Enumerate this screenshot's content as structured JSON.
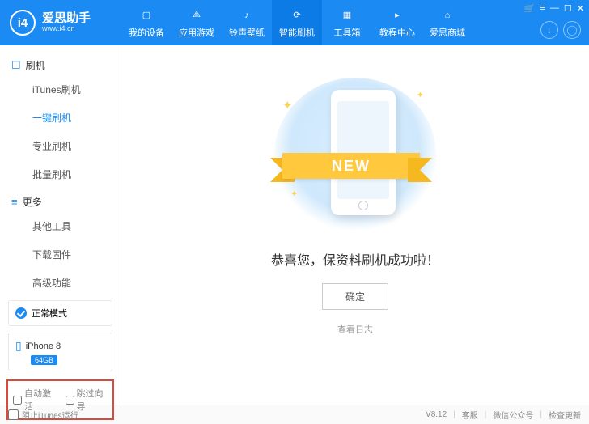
{
  "logo": {
    "badge": "i4",
    "title": "爱思助手",
    "url": "www.i4.cn"
  },
  "nav": [
    {
      "label": "我的设备"
    },
    {
      "label": "应用游戏"
    },
    {
      "label": "铃声壁纸"
    },
    {
      "label": "智能刷机",
      "active": true
    },
    {
      "label": "工具箱"
    },
    {
      "label": "教程中心"
    },
    {
      "label": "爱思商城"
    }
  ],
  "winbtns": [
    "🛒",
    "≡",
    "—",
    "☐",
    "✕"
  ],
  "sidebar": {
    "groups": [
      {
        "icon": "☐",
        "title": "刷机",
        "items": [
          {
            "label": "iTunes刷机"
          },
          {
            "label": "一键刷机",
            "active": true
          },
          {
            "label": "专业刷机"
          },
          {
            "label": "批量刷机"
          }
        ]
      },
      {
        "icon": "≡",
        "title": "更多",
        "items": [
          {
            "label": "其他工具"
          },
          {
            "label": "下载固件"
          },
          {
            "label": "高级功能"
          }
        ]
      }
    ],
    "status": "正常模式",
    "device": {
      "name": "iPhone 8",
      "storage": "64GB"
    },
    "checks": [
      "自动激活",
      "跳过向导"
    ]
  },
  "main": {
    "ribbon": "NEW",
    "message": "恭喜您，保资料刷机成功啦！",
    "button": "确定",
    "loglink": "查看日志"
  },
  "footer": {
    "block_itunes": "阻止iTunes运行",
    "version": "V8.12",
    "links": [
      "客服",
      "微信公众号",
      "检查更新"
    ]
  }
}
